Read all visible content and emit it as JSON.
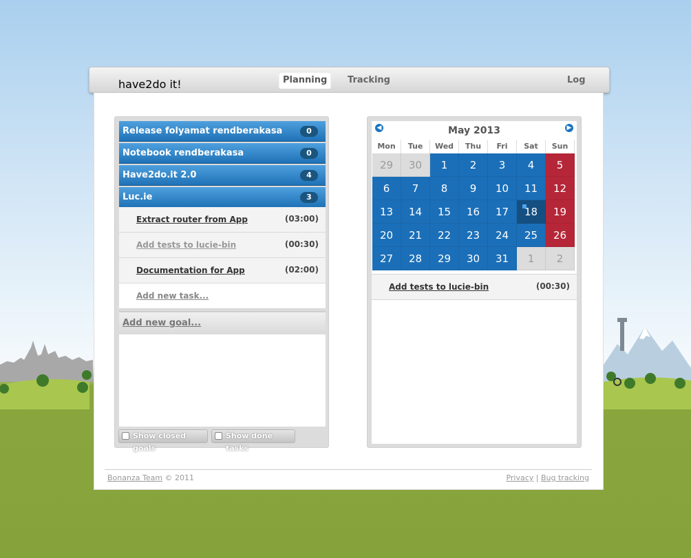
{
  "header": {
    "logo_part1": "have",
    "logo_part2": "2",
    "logo_part3": "do it!",
    "nav": [
      {
        "label": "Planning"
      },
      {
        "label": "Tracking"
      },
      {
        "label": "Log out"
      }
    ]
  },
  "goals": [
    {
      "label": "Release folyamat rendberakasa",
      "count": "0"
    },
    {
      "label": "Notebook rendberakasa",
      "count": "0"
    },
    {
      "label": "Have2do.it 2.0",
      "count": "4"
    },
    {
      "label": "Luc.ie",
      "count": "3"
    }
  ],
  "tasks": [
    {
      "label": "Extract router from App",
      "time": "(03:00)"
    },
    {
      "label": "Add tests to lucie-bin",
      "time": "(00:30)"
    },
    {
      "label": "Documentation for App",
      "time": "(02:00)"
    }
  ],
  "add_task": "Add new task...",
  "add_goal": "Add new goal...",
  "checkboxes": {
    "show_closed_goals": "Show closed goals",
    "show_done_tasks": "Show done tasks"
  },
  "calendar": {
    "title": "May 2013",
    "weekdays": [
      "Mon",
      "Tue",
      "Wed",
      "Thu",
      "Fri",
      "Sat",
      "Sun"
    ],
    "days": [
      [
        "29",
        "30",
        "1",
        "2",
        "3",
        "4",
        "5"
      ],
      [
        "6",
        "7",
        "8",
        "9",
        "10",
        "11",
        "12"
      ],
      [
        "13",
        "14",
        "15",
        "16",
        "17",
        "18",
        "19"
      ],
      [
        "20",
        "21",
        "22",
        "23",
        "24",
        "25",
        "26"
      ],
      [
        "27",
        "28",
        "29",
        "30",
        "31",
        "1",
        "2"
      ]
    ],
    "selected_task": {
      "label": "Add tests to lucie-bin",
      "time": "(00:30)"
    },
    "colors": {
      "current_month": "#1b6fb8",
      "sunday": "#b52638",
      "other_month": "#dcdcdc",
      "today": "#154f82"
    }
  },
  "footer": {
    "team": "Bonanza Team",
    "copyright": "© 2011",
    "privacy": "Privacy",
    "separator": "|",
    "bug_tracking": "Bug tracking"
  }
}
